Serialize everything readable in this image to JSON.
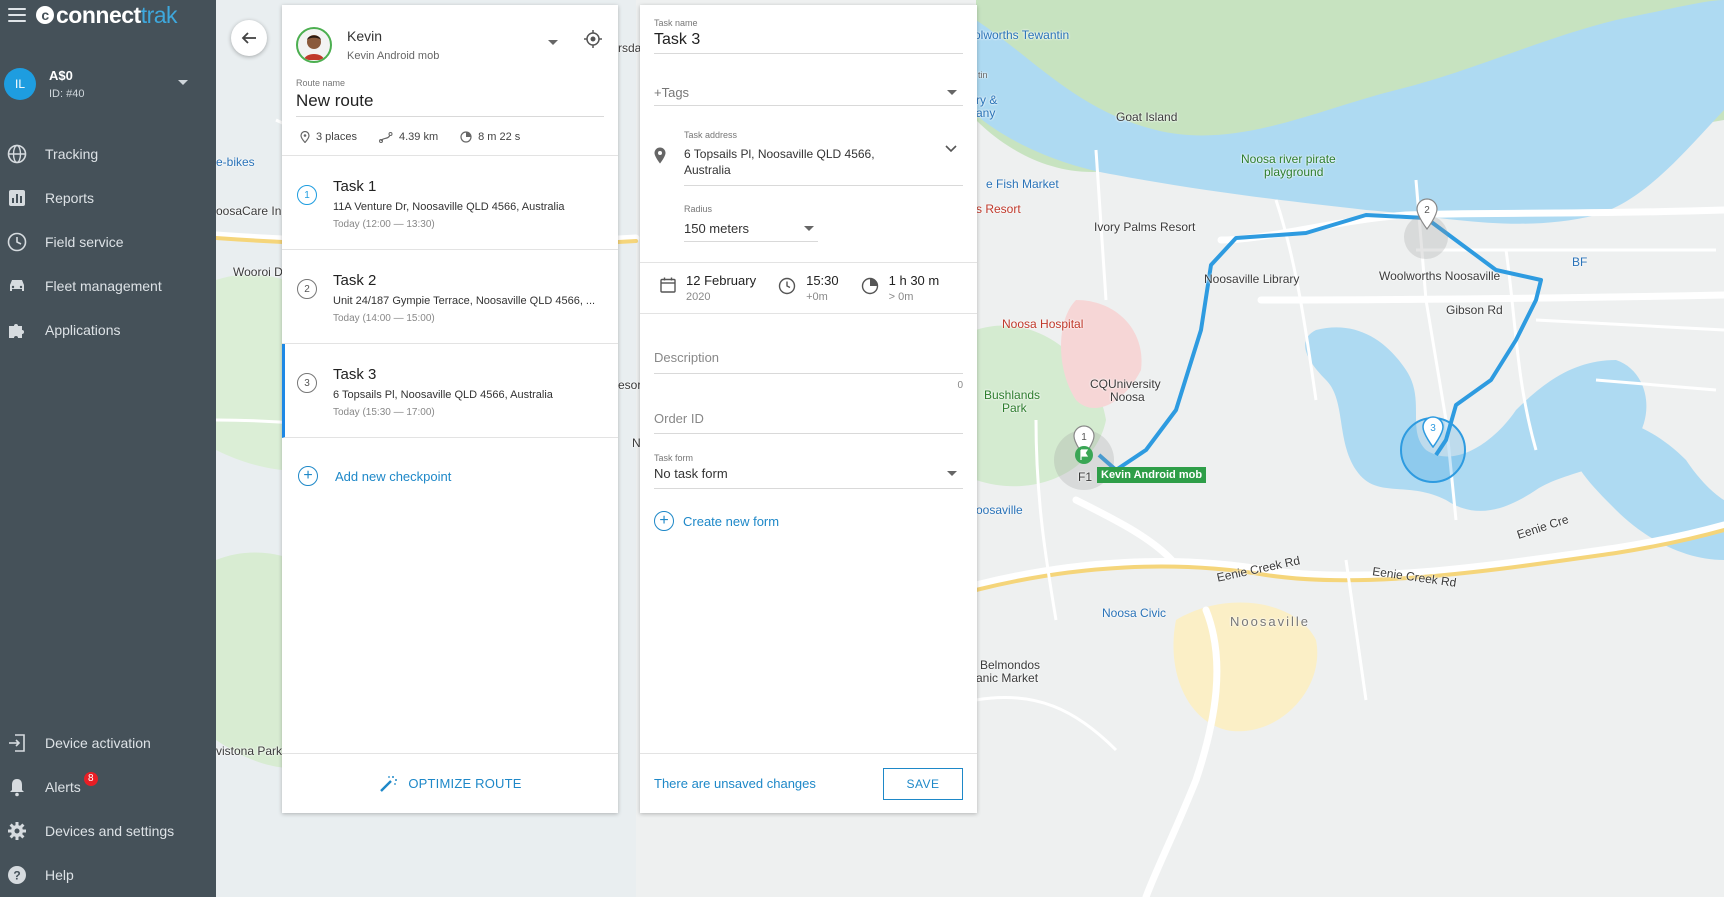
{
  "app": {
    "logo_part1": "connect",
    "logo_part2": "trak"
  },
  "account": {
    "initials": "IL",
    "name": "A$0",
    "id": "ID: #40"
  },
  "nav": {
    "items": [
      {
        "label": "Tracking",
        "icon": "globe-icon"
      },
      {
        "label": "Reports",
        "icon": "bar-chart-icon"
      },
      {
        "label": "Field service",
        "icon": "clock-icon"
      },
      {
        "label": "Fleet management",
        "icon": "car-icon"
      },
      {
        "label": "Applications",
        "icon": "puzzle-icon"
      }
    ],
    "bottom": [
      {
        "label": "Device activation",
        "icon": "login-icon"
      },
      {
        "label": "Alerts",
        "icon": "bell-icon",
        "badge": "8"
      },
      {
        "label": "Devices and settings",
        "icon": "gear-icon"
      },
      {
        "label": "Help",
        "icon": "help-icon"
      }
    ]
  },
  "route": {
    "driver_name": "Kevin",
    "driver_device": "Kevin Android mob",
    "name_label": "Route name",
    "name": "New route",
    "places": "3 places",
    "distance": "4.39 km",
    "duration": "8 m 22 s",
    "tasks": [
      {
        "num": "1",
        "title": "Task 1",
        "address": "11A Venture Dr, Noosaville QLD 4566, Australia",
        "time": "Today (12:00 — 13:30)"
      },
      {
        "num": "2",
        "title": "Task 2",
        "address": "Unit 24/187 Gympie Terrace, Noosaville QLD 4566, ...",
        "time": "Today (14:00 — 15:00)"
      },
      {
        "num": "3",
        "title": "Task 3",
        "address": "6 Topsails Pl, Noosaville QLD 4566, Australia",
        "time": "Today (15:30 — 17:00)"
      }
    ],
    "add_checkpoint": "Add new checkpoint",
    "optimize": "OPTIMIZE ROUTE"
  },
  "task": {
    "name_label": "Task name",
    "name": "Task 3",
    "tags_placeholder": "+Tags",
    "address_label": "Task address",
    "address": "6 Topsails Pl, Noosaville QLD 4566, Australia",
    "radius_label": "Radius",
    "radius": "150 meters",
    "date": "12 February",
    "year": "2020",
    "time": "15:30",
    "time_offset": "+0m",
    "duration": "1 h 30 m",
    "duration_sub": "> 0m",
    "description_placeholder": "Description",
    "description_count": "0",
    "order_placeholder": "Order ID",
    "form_label": "Task form",
    "form_value": "No task form",
    "create_form": "Create new form",
    "unsaved": "There are unsaved changes",
    "save": "SAVE"
  },
  "map": {
    "labels": [
      "olworths Tewantin",
      "Goat Island",
      "Noosa river pirate",
      "playground",
      "e Fish Market",
      "s Resort",
      "Ivory Palms Resort",
      "Noosaville Library",
      "Woolworths Noosaville",
      "Gibson Rd",
      "Noosa Hospital",
      "CQUniversity",
      "Noosa",
      "Bushlands",
      "Park",
      "oosaville",
      "Noosa Civic",
      "Noosaville",
      "Belmondos",
      "anic Market",
      "Eenie Creek Rd",
      "Eenie Creek Rd",
      "Eenie Cre",
      "e-bikes",
      "oosaCare In",
      "Wooroi D",
      "vistona Park",
      "rsda",
      "esor",
      "N",
      "F1",
      "tin",
      "ry &",
      "any",
      "BF"
    ],
    "device_tag": "Kevin Android mob",
    "markers": [
      "1",
      "2",
      "3"
    ],
    "route_color": "#2e9be0"
  }
}
